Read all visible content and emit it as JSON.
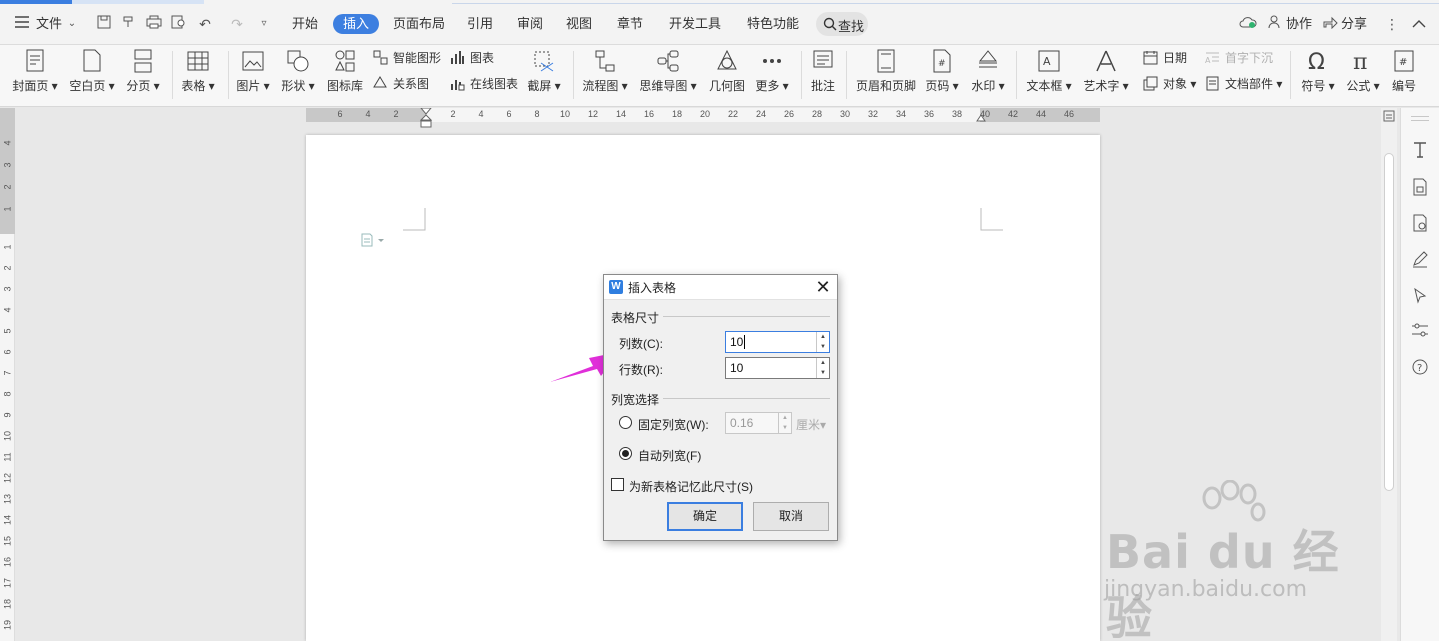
{
  "menu": {
    "file_label": "文件",
    "tabs": [
      "开始",
      "插入",
      "页面布局",
      "引用",
      "审阅",
      "视图",
      "章节",
      "开发工具",
      "特色功能"
    ],
    "active_tab": "插入",
    "search_label": "查找",
    "collab_label": "协作",
    "share_label": "分享"
  },
  "ribbon": {
    "cover": "封面页",
    "blank": "空白页",
    "pagebreak": "分页",
    "table": "表格",
    "picture": "图片",
    "shape": "形状",
    "iconlib": "图标库",
    "smartart": "智能图形",
    "relation": "关系图",
    "chart": "图表",
    "onlinechart": "在线图表",
    "screenshot": "截屏",
    "flowchart": "流程图",
    "mindmap": "思维导图",
    "geometry": "几何图",
    "more": "更多",
    "comment": "批注",
    "headerfooter": "页眉和页脚",
    "pagenum": "页码",
    "watermark": "水印",
    "textbox": "文本框",
    "wordart": "艺术字",
    "date": "日期",
    "object": "对象",
    "dropcap": "首字下沉",
    "docparts": "文档部件",
    "symbol": "符号",
    "formula": "公式",
    "numbering": "编号"
  },
  "ruler": {
    "h_ticks": [
      "6",
      "4",
      "2",
      "2",
      "4",
      "6",
      "8",
      "10",
      "12",
      "14",
      "16",
      "18",
      "20",
      "22",
      "24",
      "26",
      "28",
      "30",
      "32",
      "34",
      "36",
      "38",
      "40",
      "42",
      "44",
      "46"
    ],
    "v_ticks": [
      "4",
      "3",
      "2",
      "1",
      "1",
      "2",
      "3",
      "4",
      "5",
      "6",
      "7",
      "8",
      "9",
      "10",
      "11",
      "12",
      "13",
      "14",
      "15",
      "16",
      "17",
      "18",
      "19"
    ]
  },
  "dialog": {
    "title": "插入表格",
    "size_group": "表格尺寸",
    "cols_label": "列数(C):",
    "cols_value": "10",
    "rows_label": "行数(R):",
    "rows_value": "10",
    "width_group": "列宽选择",
    "fixed_label": "固定列宽(W):",
    "fixed_value": "0.16",
    "fixed_unit": "厘米",
    "auto_label": "自动列宽(F)",
    "remember_label": "为新表格记忆此尺寸(S)",
    "ok_label": "确定",
    "cancel_label": "取消",
    "auto_selected": true,
    "remember_checked": false
  },
  "watermark": {
    "brand": "Bai du 经验",
    "url": "jingyan.baidu.com"
  },
  "colors": {
    "accent": "#3b7ee0",
    "arrow": "#e02fd9"
  }
}
